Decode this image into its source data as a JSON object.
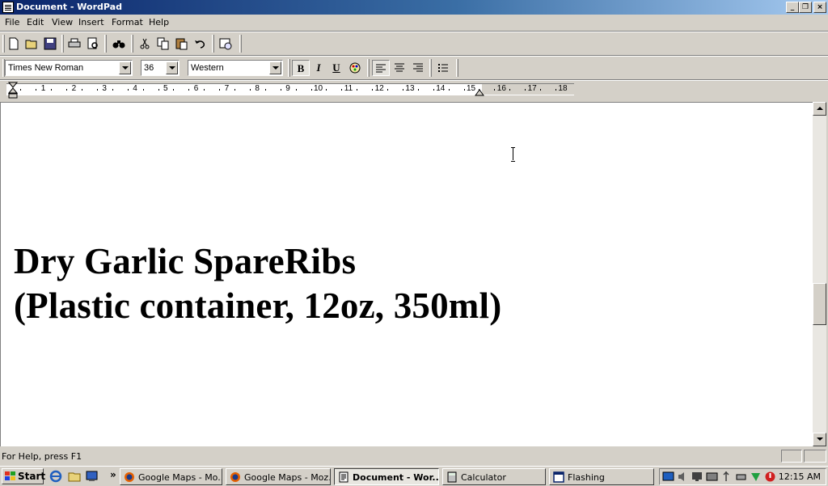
{
  "window": {
    "title": "Document - WordPad"
  },
  "menu": {
    "file": "File",
    "edit": "Edit",
    "view": "View",
    "insert": "Insert",
    "format": "Format",
    "help": "Help"
  },
  "format_bar": {
    "font": "Times New Roman",
    "size": "36",
    "script": "Western",
    "bold_label": "B",
    "italic_label": "I",
    "underline_label": "U"
  },
  "ruler": {
    "numbers": [
      "1",
      "2",
      "3",
      "4",
      "5",
      "6",
      "7",
      "8",
      "9",
      "10",
      "11",
      "12",
      "13",
      "14",
      "15",
      "16",
      "17",
      "18"
    ]
  },
  "document": {
    "lines": [
      "Dry Garlic SpareRibs",
      "(Plastic container, 12oz, 350ml)"
    ]
  },
  "status": {
    "help_text": "For Help, press F1"
  },
  "taskbar": {
    "start": "Start",
    "quicklaunch_more": "»",
    "tasks": [
      {
        "label": "Google Maps - Mo...",
        "icon": "firefox-icon",
        "active": false
      },
      {
        "label": "Google Maps - Moz...",
        "icon": "firefox-icon",
        "active": false
      },
      {
        "label": "Document - Wor...",
        "icon": "wordpad-icon",
        "active": true
      },
      {
        "label": "Calculator",
        "icon": "calculator-icon",
        "active": false
      },
      {
        "label": "Flashing",
        "icon": "window-icon",
        "active": false
      }
    ],
    "clock": "12:15 AM"
  },
  "colors": {
    "titlebar_start": "#0a246a",
    "titlebar_end": "#a6caf0",
    "face": "#d4d0c8"
  }
}
